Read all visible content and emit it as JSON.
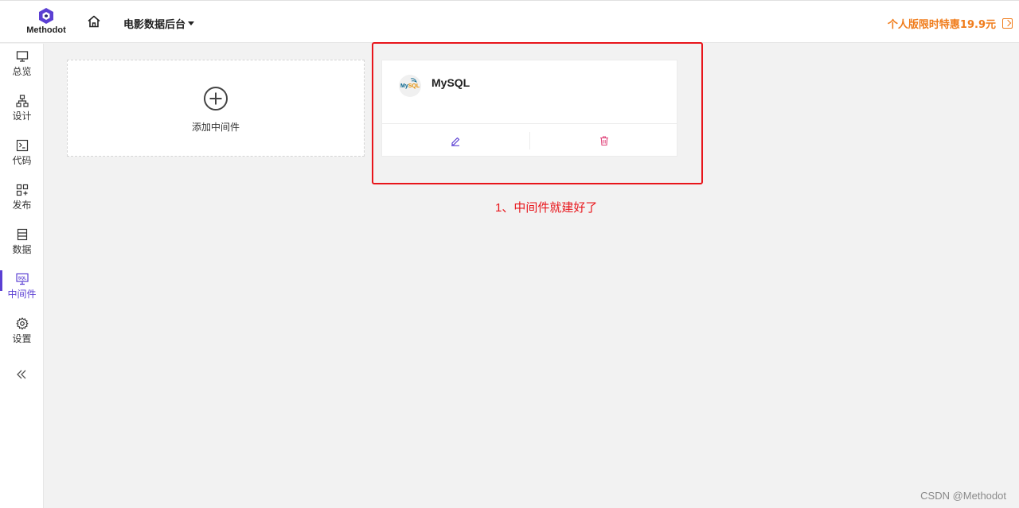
{
  "brand": {
    "name": "Methodot"
  },
  "header": {
    "app_name": "电影数据后台",
    "promo_text": "个人版限时特惠19.9元"
  },
  "sidebar": {
    "items": [
      {
        "label": "总览",
        "icon": "monitor-icon"
      },
      {
        "label": "设计",
        "icon": "sitemap-icon"
      },
      {
        "label": "代码",
        "icon": "terminal-icon"
      },
      {
        "label": "发布",
        "icon": "apps-icon"
      },
      {
        "label": "数据",
        "icon": "database-icon"
      },
      {
        "label": "中间件",
        "icon": "sql-monitor-icon",
        "active": true
      },
      {
        "label": "设置",
        "icon": "gear-icon"
      }
    ]
  },
  "main": {
    "add_card_label": "添加中间件",
    "middleware": [
      {
        "name": "MySQL",
        "logo_text_a": "My",
        "logo_text_b": "SQL"
      }
    ]
  },
  "annotation": "1、中间件就建好了",
  "watermark": "CSDN @Methodot",
  "colors": {
    "accent": "#5b3fd3",
    "promo": "#f07c1b",
    "danger": "#e8151b",
    "delete": "#e0457b"
  }
}
